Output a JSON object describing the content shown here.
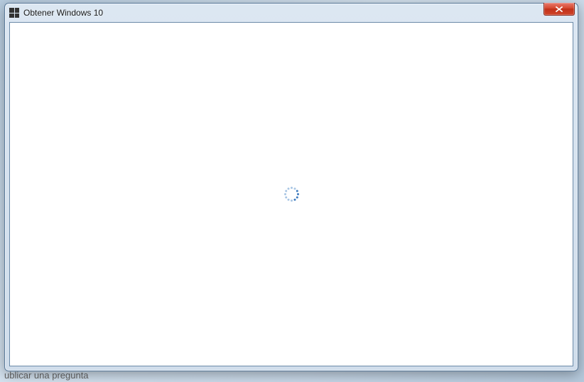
{
  "window": {
    "title": "Obtener Windows 10",
    "icon_name": "windows-logo-icon"
  },
  "spinner": {
    "dot_color_light": "#a9c6e4",
    "dot_color_dark": "#3e7bbf"
  },
  "background": {
    "peek_text_bottom": "ublicar una pregunta"
  },
  "close_button": {
    "label": "Close"
  }
}
